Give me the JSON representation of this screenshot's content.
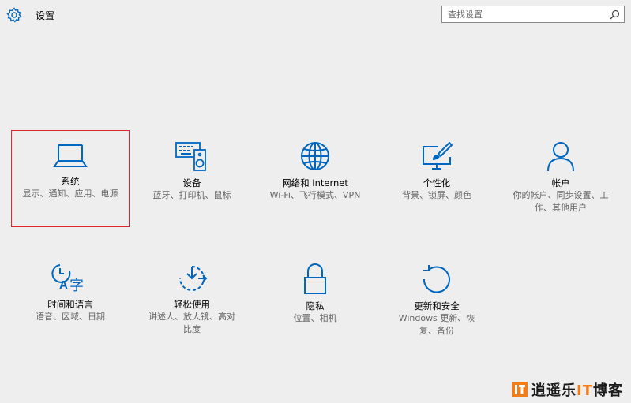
{
  "app": {
    "title": "设置"
  },
  "search": {
    "placeholder": "查找设置"
  },
  "accent_color": "#0067c0",
  "highlight_color": "#e0242a",
  "tiles": [
    {
      "label": "系统",
      "desc": "显示、通知、应用、电源",
      "icon": "laptop-icon",
      "highlighted": true
    },
    {
      "label": "设备",
      "desc": "蓝牙、打印机、鼠标",
      "icon": "devices-icon"
    },
    {
      "label": "网络和 Internet",
      "desc": "Wi-Fi、飞行模式、VPN",
      "icon": "globe-icon"
    },
    {
      "label": "个性化",
      "desc": "背景、锁屏、颜色",
      "icon": "personalization-icon"
    },
    {
      "label": "帐户",
      "desc": "你的帐户、同步设置、工作、其他用户",
      "icon": "person-icon"
    },
    {
      "label": "时间和语言",
      "desc": "语音、区域、日期",
      "icon": "time-language-icon"
    },
    {
      "label": "轻松使用",
      "desc": "讲述人、放大镜、高对比度",
      "icon": "ease-of-access-icon"
    },
    {
      "label": "隐私",
      "desc": "位置、相机",
      "icon": "lock-icon"
    },
    {
      "label": "更新和安全",
      "desc": "Windows 更新、恢复、备份",
      "icon": "refresh-icon"
    }
  ],
  "watermark": {
    "text": "逍遥乐",
    "accent": "IT",
    "suffix": "博客"
  }
}
